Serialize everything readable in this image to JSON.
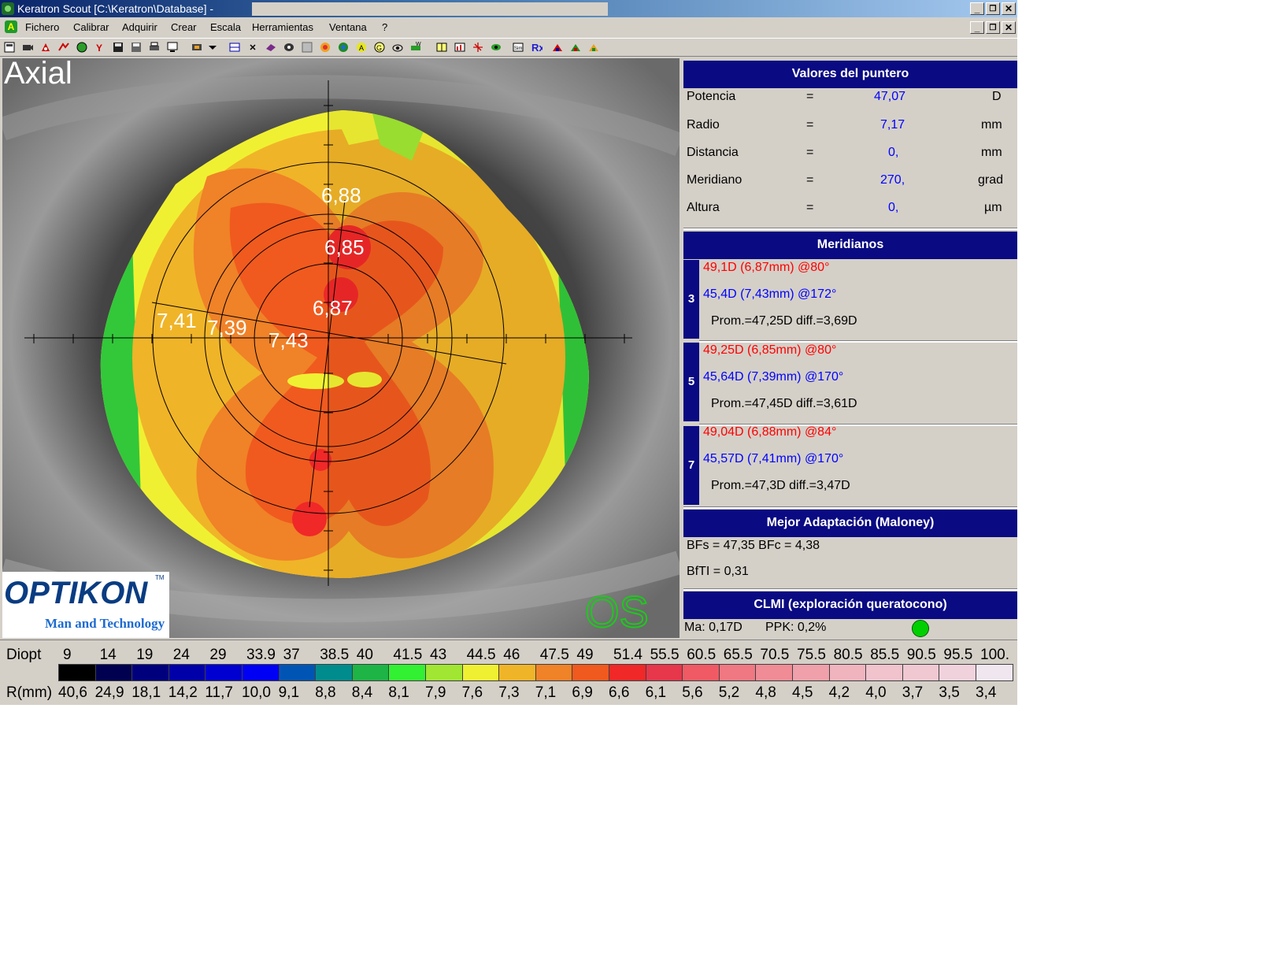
{
  "window": {
    "title": "Keratron Scout [C:\\Keratron\\Database] -"
  },
  "menu": [
    "Fichero",
    "Calibrar",
    "Adquirir",
    "Crear",
    "Escala",
    "Herramientas",
    "Ventana",
    "?"
  ],
  "map": {
    "mode_label": "Axial",
    "eye_label": "OS",
    "brand": "OPTIKON",
    "brand_tm": "TM",
    "brand_tagline": "Man and Technology",
    "overlay_values": [
      "6,88",
      "6,85",
      "6,87",
      "7,41",
      "7,39",
      "7,43"
    ]
  },
  "pointer": {
    "header": "Valores del puntero",
    "rows": [
      {
        "label": "Potencia",
        "eq": "=",
        "value": "47,07",
        "unit": "D"
      },
      {
        "label": "Radio",
        "eq": "=",
        "value": "7,17",
        "unit": "mm"
      },
      {
        "label": "Distancia",
        "eq": "=",
        "value": "0,",
        "unit": "mm"
      },
      {
        "label": "Meridiano",
        "eq": "=",
        "value": "270,",
        "unit": "grad"
      },
      {
        "label": "Altura",
        "eq": "=",
        "value": "0,",
        "unit": "µm"
      }
    ]
  },
  "meridians": {
    "header": "Meridianos",
    "groups": [
      {
        "ring": "3",
        "steep": "49,1D (6,87mm) @80°",
        "flat": "45,4D (7,43mm) @172°",
        "summary": "Prom.=47,25D  diff.=3,69D"
      },
      {
        "ring": "5",
        "steep": "49,25D (6,85mm) @80°",
        "flat": "45,64D (7,39mm) @170°",
        "summary": "Prom.=47,45D  diff.=3,61D"
      },
      {
        "ring": "7",
        "steep": "49,04D (6,88mm) @84°",
        "flat": "45,57D (7,41mm) @170°",
        "summary": "Prom.=47,3D  diff.=3,47D"
      }
    ]
  },
  "best_fit": {
    "header": "Mejor Adaptación (Maloney)",
    "line1": "BFs = 47,35 BFc = 4,38",
    "line2": "BfTI = 0,31"
  },
  "clmi": {
    "header": "CLMI (exploración queratocono)",
    "ma": "Ma: 0,17D",
    "ppk": "PPK: 0,2%",
    "status_color": "#00d000"
  },
  "legend": {
    "diopt_label": "Diopt",
    "radius_label": "R(mm)",
    "diopt_values": [
      "9",
      "14",
      "19",
      "24",
      "29",
      "33.9",
      "37",
      "38.5",
      "40",
      "41.5",
      "43",
      "44.5",
      "46",
      "47.5",
      "49",
      "51.4",
      "55.5",
      "60.5",
      "65.5",
      "70.5",
      "75.5",
      "80.5",
      "85.5",
      "90.5",
      "95.5",
      "100."
    ],
    "radius_values": [
      "40,6",
      "24,9",
      "18,1",
      "14,2",
      "11,7",
      "10,0",
      "9,1",
      "8,8",
      "8,4",
      "8,1",
      "7,9",
      "7,6",
      "7,3",
      "7,1",
      "6,9",
      "6,6",
      "6,1",
      "5,6",
      "5,2",
      "4,8",
      "4,5",
      "4,2",
      "4,0",
      "3,7",
      "3,5",
      "3,4"
    ],
    "colors": [
      "#000000",
      "#000050",
      "#00007d",
      "#0000a8",
      "#0000d0",
      "#0000f5",
      "#0055b4",
      "#008c8c",
      "#1eb446",
      "#32f032",
      "#a0e632",
      "#f0f032",
      "#f0b428",
      "#f08228",
      "#f05a1e",
      "#f02828",
      "#e6374b",
      "#f05a64",
      "#f07882",
      "#f08c96",
      "#f0a0aa",
      "#f0b4be",
      "#f0c3cd",
      "#f0c8d2",
      "#f0d2dc",
      "#f0e6f0"
    ]
  }
}
